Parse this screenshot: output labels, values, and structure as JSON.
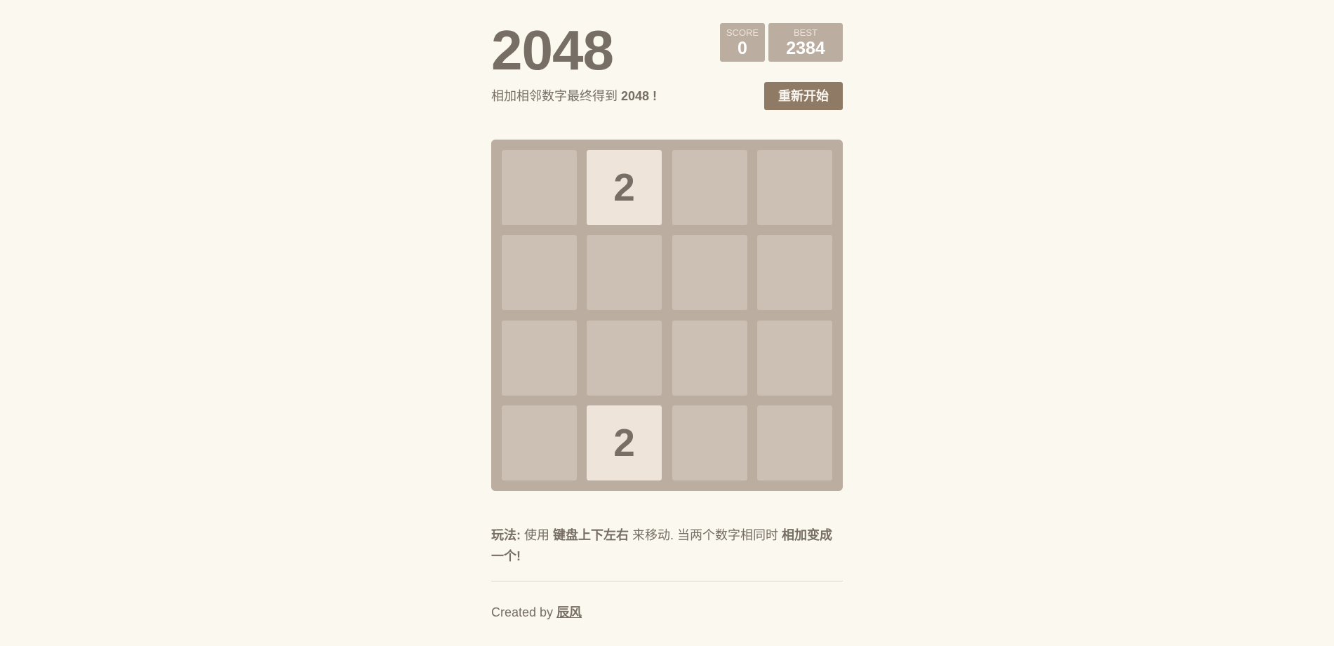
{
  "game": {
    "title": "2048",
    "subtitle_prefix": "相加相邻数字最终得到 ",
    "subtitle_bold": "2048 !",
    "restart_label": "重新开始"
  },
  "score": {
    "label": "SCORE",
    "value": "0"
  },
  "best": {
    "label": "BEST",
    "value": "2384"
  },
  "board": {
    "size": 4,
    "cells": [
      [
        "",
        "2",
        "",
        ""
      ],
      [
        "",
        "",
        "",
        ""
      ],
      [
        "",
        "",
        "",
        ""
      ],
      [
        "",
        "2",
        "",
        ""
      ]
    ]
  },
  "instructions": {
    "label": "玩法:",
    "part1": " 使用 ",
    "keys": "键盘上下左右",
    "part2": " 来移动. 当两个数字相同时 ",
    "result": "相加变成一个!"
  },
  "footer": {
    "prefix": "Created by ",
    "author": "辰风"
  },
  "colors": {
    "background": "#faf8ef",
    "board": "#bbada0",
    "empty_cell": "#cdc1b4",
    "tile_2": "#eee4da",
    "button": "#8f7a66",
    "text": "#776e65"
  }
}
